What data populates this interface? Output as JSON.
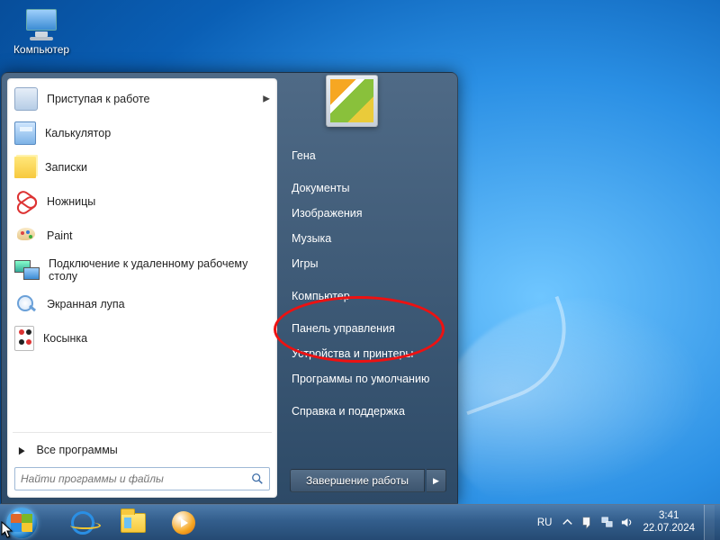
{
  "desktop": {
    "computer_label": "Компьютер"
  },
  "start_menu": {
    "programs": [
      {
        "label": "Приступая к работе",
        "icon": "ic-gs",
        "has_submenu": true
      },
      {
        "label": "Калькулятор",
        "icon": "ic-calc",
        "has_submenu": false
      },
      {
        "label": "Записки",
        "icon": "ic-note",
        "has_submenu": false
      },
      {
        "label": "Ножницы",
        "icon": "ic-snip",
        "has_submenu": false
      },
      {
        "label": "Paint",
        "icon": "ic-paint",
        "has_submenu": false
      },
      {
        "label": "Подключение к удаленному рабочему столу",
        "icon": "ic-rdp",
        "has_submenu": false
      },
      {
        "label": "Экранная лупа",
        "icon": "ic-mag",
        "has_submenu": false
      },
      {
        "label": "Косынка",
        "icon": "ic-card",
        "has_submenu": false
      }
    ],
    "all_programs_label": "Все программы",
    "search_placeholder": "Найти программы и файлы",
    "right_links": [
      "Гена",
      "Документы",
      "Изображения",
      "Музыка",
      "Игры",
      "Компьютер",
      "Панель управления",
      "Устройства и принтеры",
      "Программы по умолчанию",
      "Справка и поддержка"
    ],
    "highlight_index": 6,
    "shutdown_label": "Завершение работы"
  },
  "taskbar": {
    "lang": "RU",
    "time": "3:41",
    "date": "22.07.2024"
  }
}
